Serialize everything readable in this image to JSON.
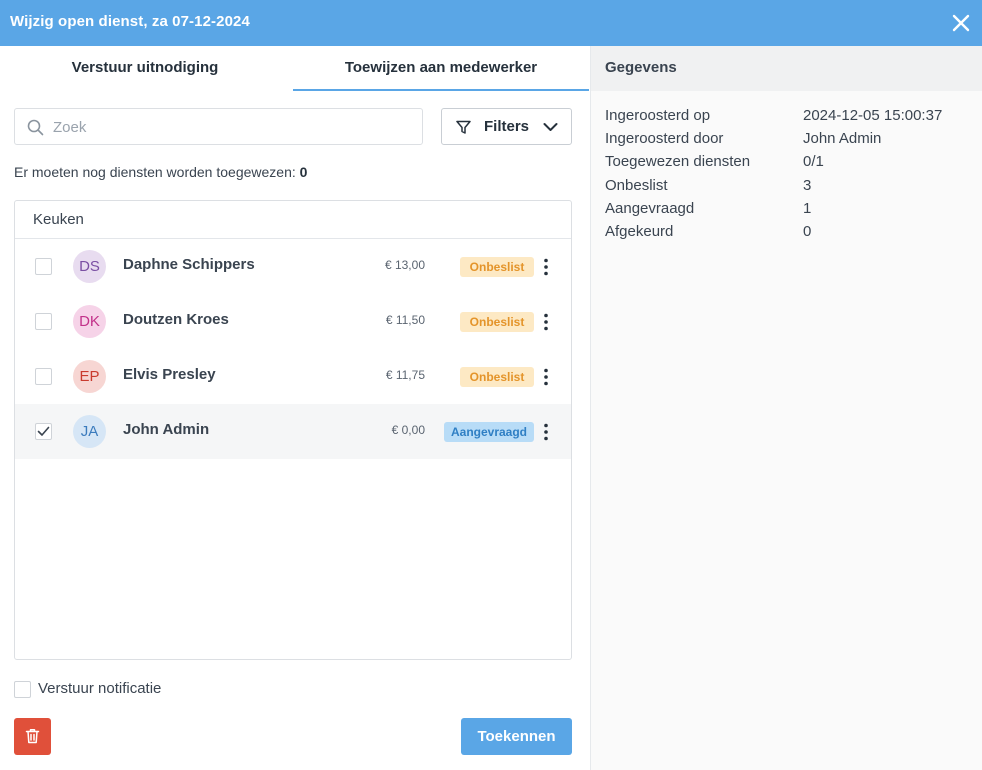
{
  "dialog": {
    "title": "Wijzig open dienst, za 07-12-2024"
  },
  "tabs": [
    {
      "label": "Verstuur uitnodiging",
      "active": false
    },
    {
      "label": "Toewijzen aan medewerker",
      "active": true
    }
  ],
  "search": {
    "placeholder": "Zoek",
    "value": ""
  },
  "filters": {
    "label": "Filters"
  },
  "remaining": {
    "text": "Er moeten nog diensten worden toegewezen: ",
    "count": "0"
  },
  "group": {
    "label": "Keuken"
  },
  "employees": [
    {
      "initials": "DS",
      "name": "Daphne Schippers",
      "wage": "€ 13,00",
      "status": "Onbeslist",
      "status_type": "undecided",
      "checked": false,
      "avatar_bg": "#e8dcf0",
      "avatar_fg": "#7a4fa3"
    },
    {
      "initials": "DK",
      "name": "Doutzen Kroes",
      "wage": "€ 11,50",
      "status": "Onbeslist",
      "status_type": "undecided",
      "checked": false,
      "avatar_bg": "#f6d3e8",
      "avatar_fg": "#c2328a"
    },
    {
      "initials": "EP",
      "name": "Elvis Presley",
      "wage": "€ 11,75",
      "status": "Onbeslist",
      "status_type": "undecided",
      "checked": false,
      "avatar_bg": "#f7d6d3",
      "avatar_fg": "#c93b2e"
    },
    {
      "initials": "JA",
      "name": "John Admin",
      "wage": "€ 0,00",
      "status": "Aangevraagd",
      "status_type": "requested",
      "checked": true,
      "avatar_bg": "#d6e6f6",
      "avatar_fg": "#3b7bbd"
    }
  ],
  "notification": {
    "label": "Verstuur notificatie",
    "checked": false
  },
  "actions": {
    "assign_label": "Toekennen"
  },
  "details": {
    "header": "Gegevens",
    "rows": [
      {
        "key": "Ingeroosterd op",
        "value": "2024-12-05 15:00:37"
      },
      {
        "key": "Ingeroosterd door",
        "value": "John Admin"
      },
      {
        "key": "Toegewezen diensten",
        "value": "0/1"
      },
      {
        "key": "Onbeslist",
        "value": "3"
      },
      {
        "key": "Aangevraagd",
        "value": "1"
      },
      {
        "key": "Afgekeurd",
        "value": "0"
      }
    ]
  },
  "colors": {
    "primary": "#5aa6e6",
    "danger": "#e0503a",
    "undecided_bg": "#fde9c4",
    "undecided_fg": "#e4942a",
    "requested_bg": "#b8dcf7",
    "requested_fg": "#2f7fc4"
  },
  "icons": {
    "close": "close-icon",
    "search": "search-icon",
    "filter": "filter-icon",
    "chevron": "chevron-down-icon",
    "kebab": "kebab-menu-icon",
    "trash": "trash-icon",
    "check": "checkmark-icon"
  }
}
